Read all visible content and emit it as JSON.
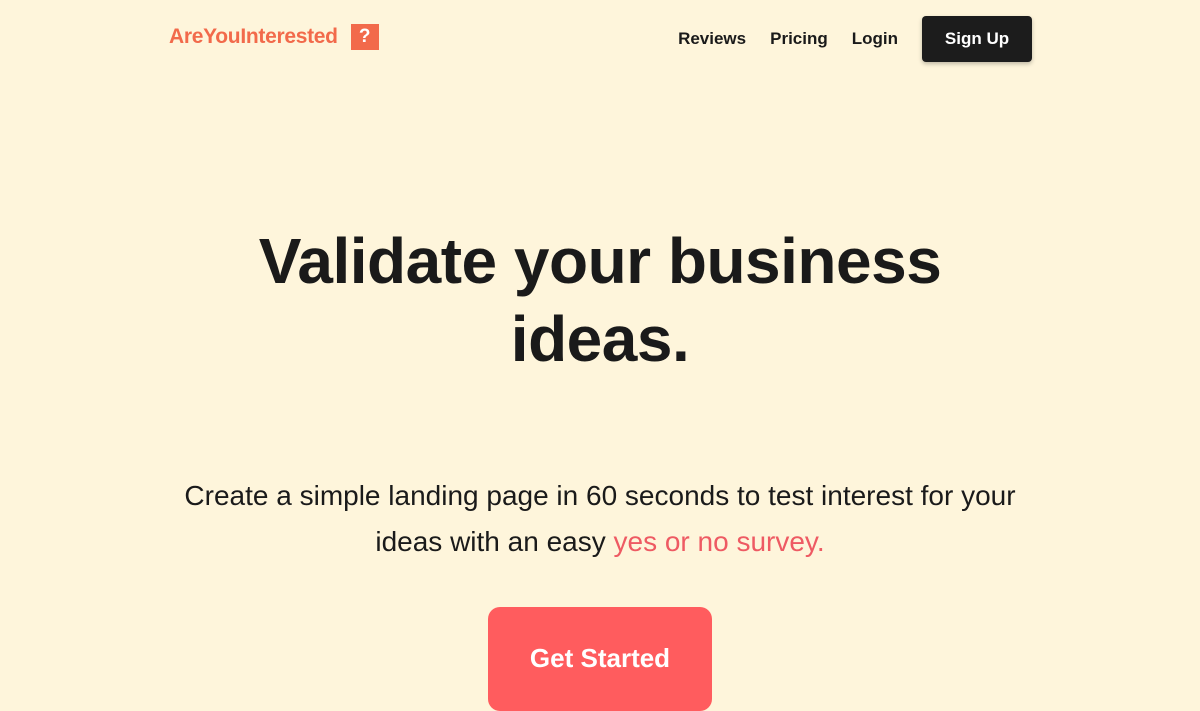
{
  "header": {
    "brand": "AreYouInterested",
    "brand_mark": "?",
    "nav": [
      {
        "label": "Reviews"
      },
      {
        "label": "Pricing"
      },
      {
        "label": "Login"
      }
    ],
    "signup_label": "Sign Up"
  },
  "hero": {
    "title_line1": "Validate your business",
    "title_line2": "ideas.",
    "subtitle_part1": "Create a simple landing page in 60 seconds to test interest for your ideas with an easy ",
    "subtitle_accent": "yes or no survey.",
    "cta_label": "Get Started"
  },
  "colors": {
    "background": "#FEF5DB",
    "brand": "#F26A4B",
    "accent": "#EE5A63",
    "cta": "#FF5C5E",
    "dark": "#1C1C1C"
  }
}
